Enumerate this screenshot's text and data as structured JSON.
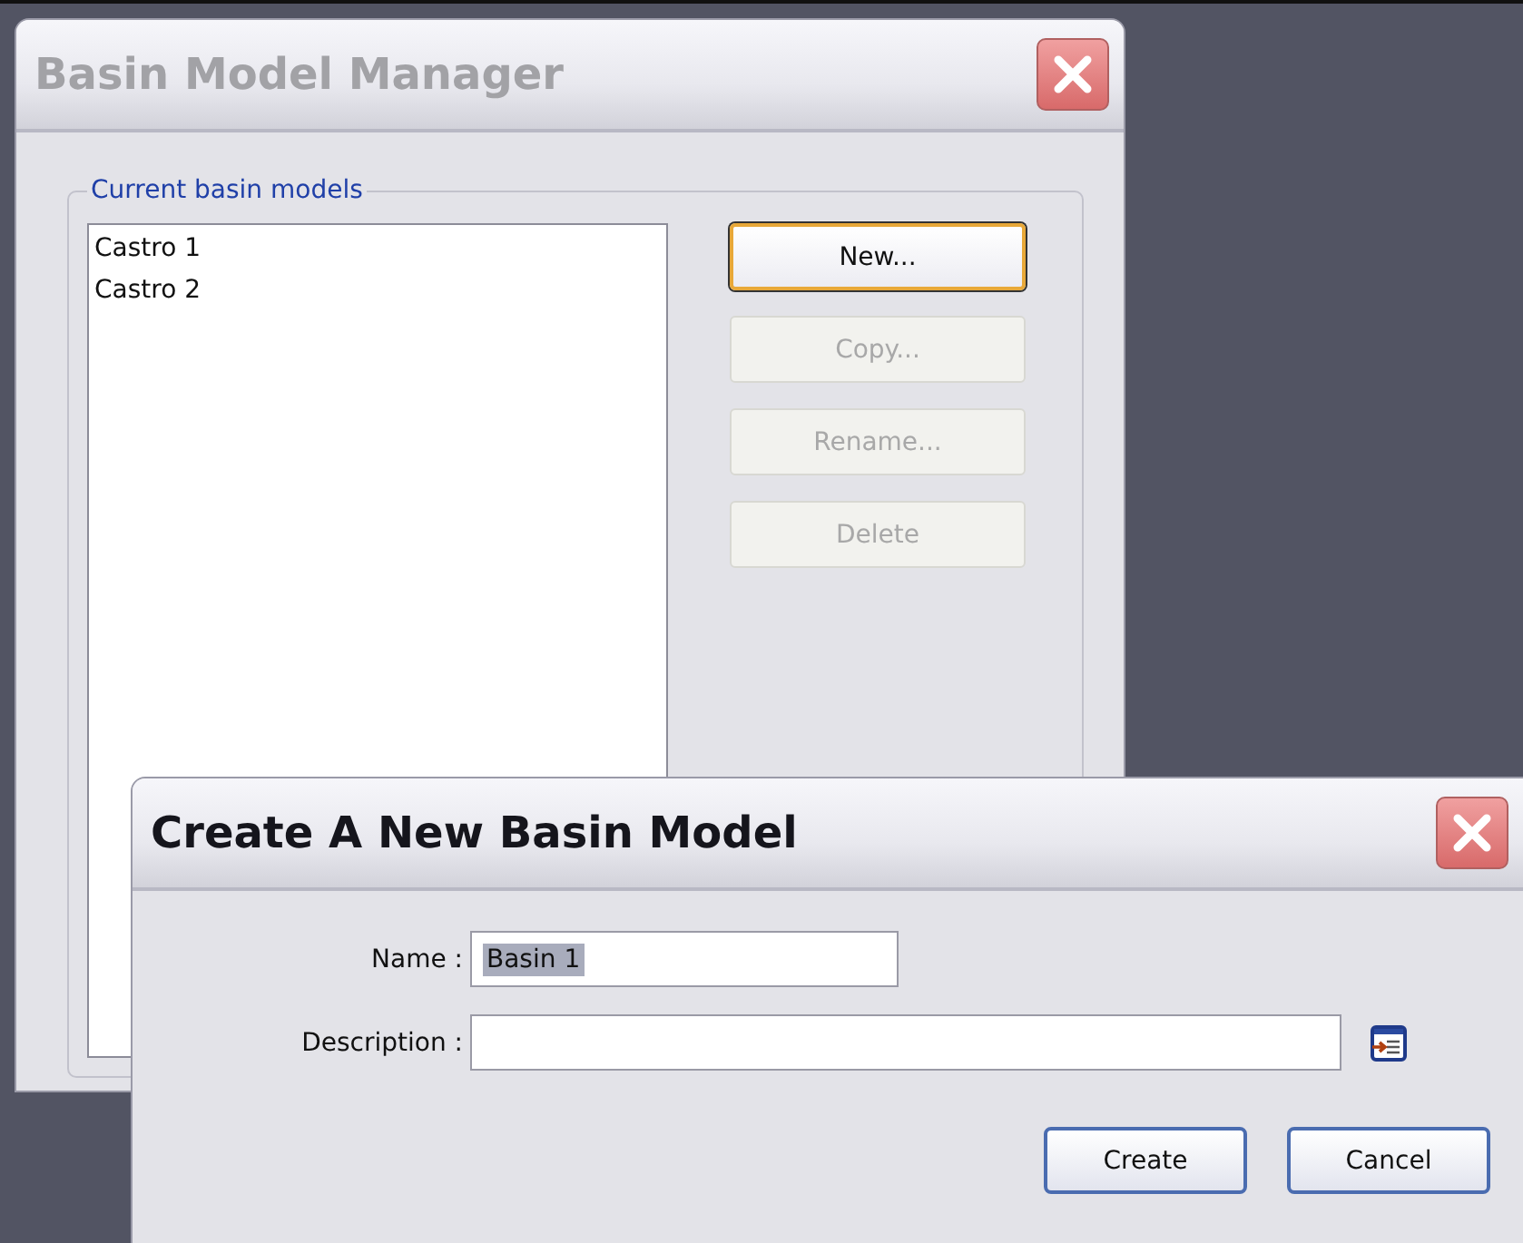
{
  "manager": {
    "title": "Basin Model Manager",
    "group_label": "Current basin models",
    "models": [
      {
        "label": "Castro 1",
        "selected": false
      },
      {
        "label": "Castro 2",
        "selected": false
      }
    ],
    "buttons": [
      {
        "label": "New...",
        "disabled": false,
        "focused": true
      },
      {
        "label": "Copy...",
        "disabled": true,
        "focused": false
      },
      {
        "label": "Rename...",
        "disabled": true,
        "focused": false
      },
      {
        "label": "Delete",
        "disabled": true,
        "focused": false
      }
    ]
  },
  "dialog": {
    "title": "Create A New Basin Model",
    "fields": [
      {
        "label": "Name :",
        "value": "Basin 1",
        "text_selected": true,
        "kind": "short"
      },
      {
        "label": "Description :",
        "kind": "long"
      }
    ],
    "buttons": [
      {
        "label": "Create"
      },
      {
        "label": "Cancel"
      }
    ]
  }
}
